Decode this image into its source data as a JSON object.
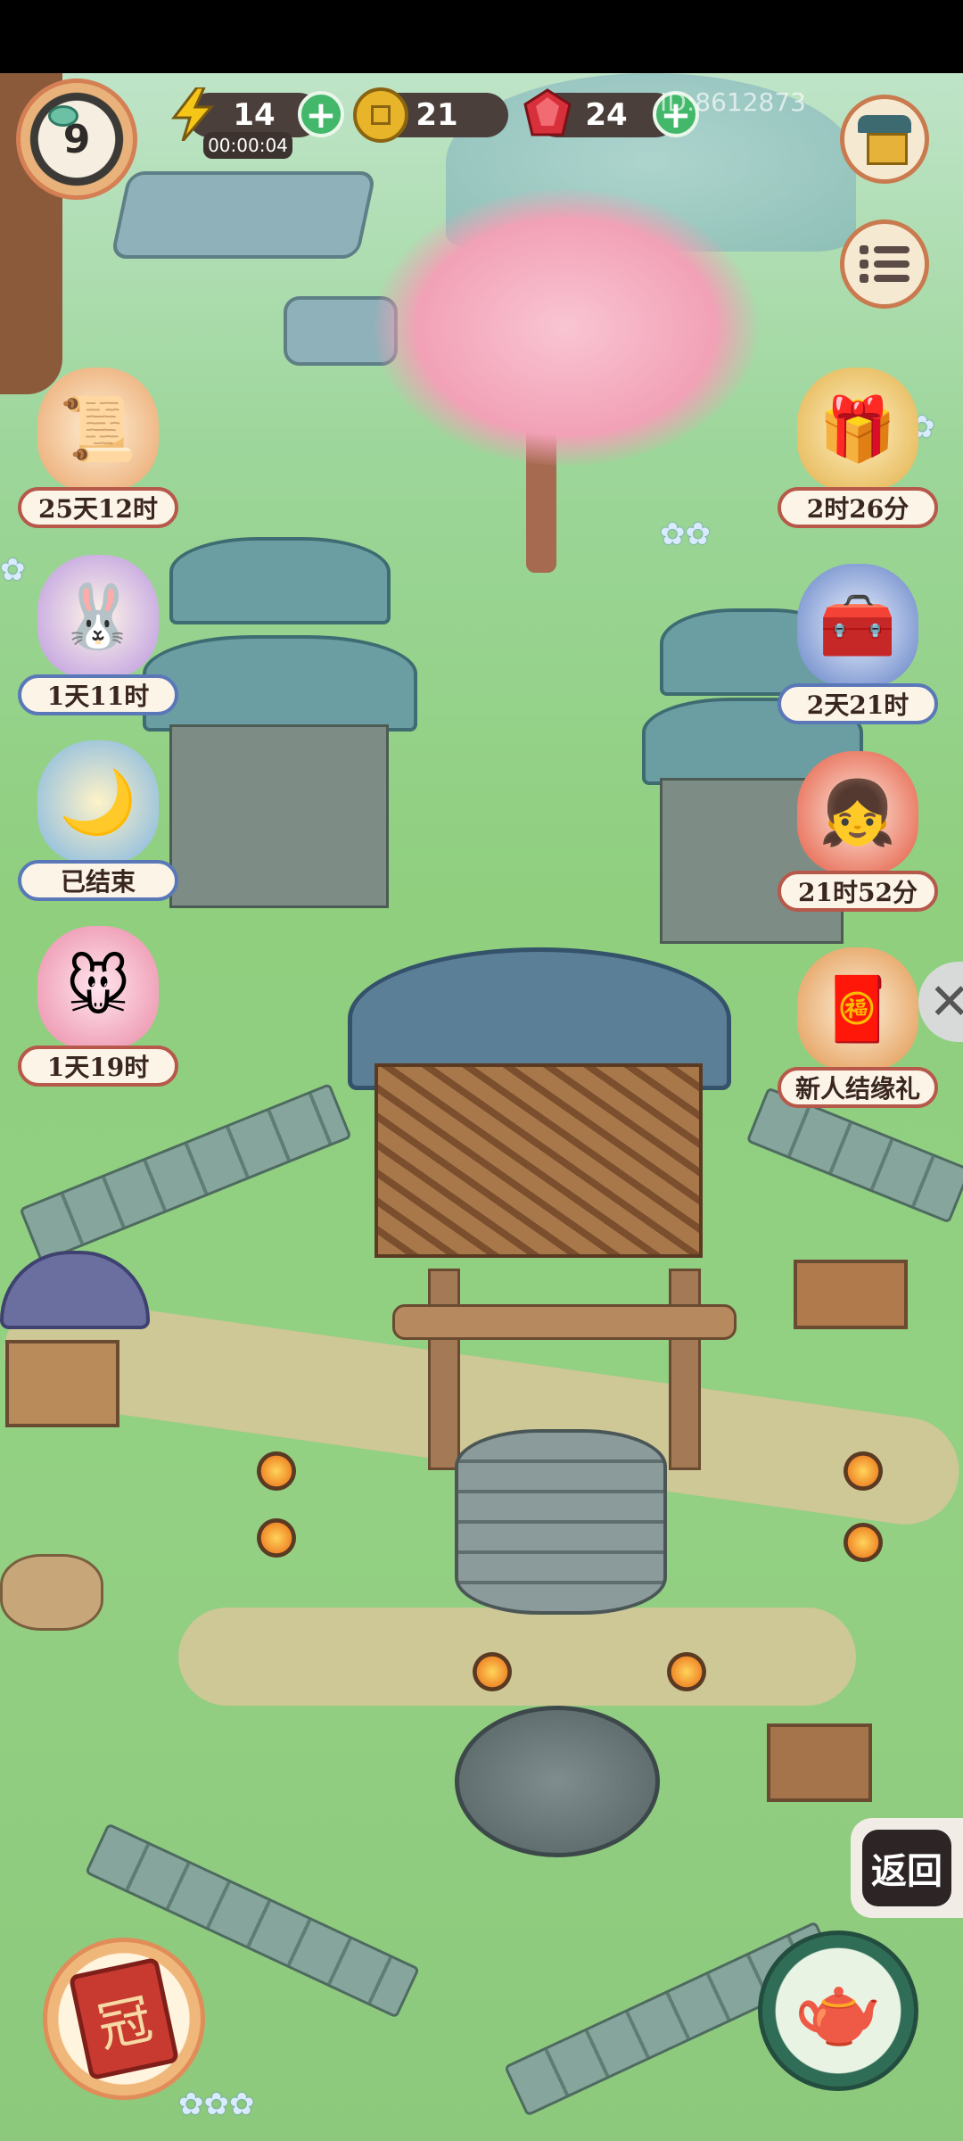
{
  "hud": {
    "level": "9",
    "energy": "14",
    "energy_timer": "00:00:04",
    "coins": "21",
    "gems": "24",
    "uid": "ID:8612873",
    "plus_symbol": "+"
  },
  "events_left": [
    {
      "label": "25天12时",
      "icon": "scroll-icon"
    },
    {
      "label": "1天11时",
      "icon": "rabbit-lantern-icon"
    },
    {
      "label": "已结束",
      "icon": "moon-rabbit-icon"
    },
    {
      "label": "1天19时",
      "icon": "mouse-gift-icon"
    }
  ],
  "events_right": [
    {
      "label": "2时26分",
      "icon": "golden-box-icon"
    },
    {
      "label": "2天21时",
      "icon": "treasure-chest-icon"
    },
    {
      "label": "21时52分",
      "icon": "maiden-icon"
    },
    {
      "label": "新人结缘礼",
      "icon": "newcomer-gift-icon"
    }
  ],
  "back_button": "返回",
  "colors": {
    "energy": "#f5c518",
    "coin": "#e8b42a",
    "gem": "#d8303a",
    "plus": "#43b86a",
    "hud_pill": "#4a3f3a"
  }
}
